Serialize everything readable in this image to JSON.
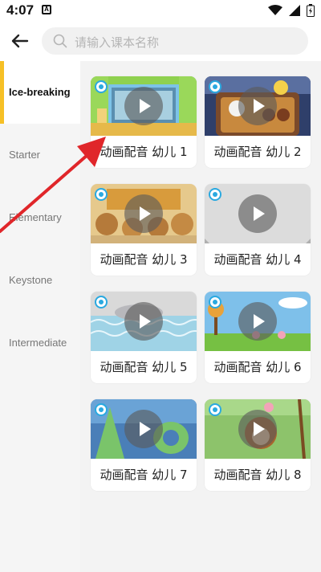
{
  "status_bar": {
    "time": "4:07",
    "notification": "A"
  },
  "search": {
    "placeholder": "请输入课本名称"
  },
  "sidebar": {
    "items": [
      {
        "label": "Ice-breaking",
        "active": true
      },
      {
        "label": "Starter",
        "active": false
      },
      {
        "label": "Elementary",
        "active": false
      },
      {
        "label": "Keystone",
        "active": false
      },
      {
        "label": "Intermediate",
        "active": false
      }
    ]
  },
  "cards": [
    {
      "title": "动画配音 幼儿 1"
    },
    {
      "title": "动画配音 幼儿 2"
    },
    {
      "title": "动画配音 幼儿 3"
    },
    {
      "title": "动画配音 幼儿 4"
    },
    {
      "title": "动画配音 幼儿 5"
    },
    {
      "title": "动画配音 幼儿 6"
    },
    {
      "title": "动画配音 幼儿 7"
    },
    {
      "title": "动画配音 幼儿 8"
    }
  ],
  "colors": {
    "accent": "#f6c026",
    "badge": "#2aa9e0",
    "arrow": "#e0262a"
  }
}
